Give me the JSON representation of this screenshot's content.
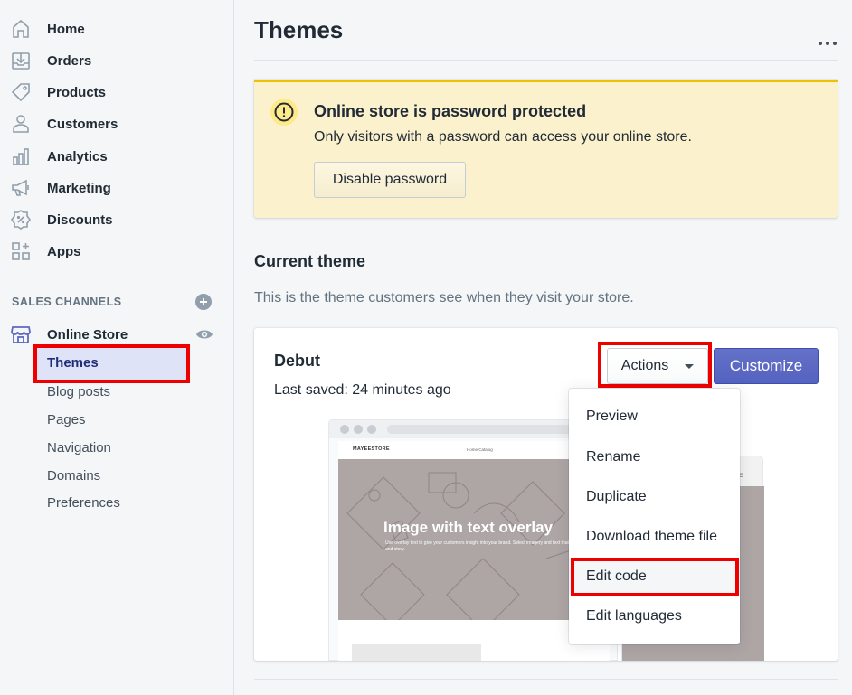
{
  "sidebar": {
    "items": [
      {
        "label": "Home",
        "icon": "home-icon"
      },
      {
        "label": "Orders",
        "icon": "orders-icon"
      },
      {
        "label": "Products",
        "icon": "tag-icon"
      },
      {
        "label": "Customers",
        "icon": "person-icon"
      },
      {
        "label": "Analytics",
        "icon": "bar-chart-icon"
      },
      {
        "label": "Marketing",
        "icon": "megaphone-icon"
      },
      {
        "label": "Discounts",
        "icon": "discount-badge-icon"
      },
      {
        "label": "Apps",
        "icon": "apps-grid-icon"
      }
    ],
    "sales_channels_title": "SALES CHANNELS",
    "online_store": {
      "label": "Online Store",
      "active_sub": "Themes",
      "sub_items": [
        "Blog posts",
        "Pages",
        "Navigation",
        "Domains",
        "Preferences"
      ]
    }
  },
  "main": {
    "title": "Themes",
    "banner": {
      "title": "Online store is password protected",
      "text": "Only visitors with a password can access your online store.",
      "button": "Disable password",
      "accent": "#eec200",
      "background": "#fcf1cd"
    },
    "current_theme": {
      "heading": "Current theme",
      "description": "This is the theme customers see when they visit your store.",
      "name": "Debut",
      "saved": "Last saved: 24 minutes ago",
      "actions_label": "Actions",
      "customize_label": "Customize",
      "preview": {
        "logo": "MAYEESTORE",
        "nav": "Home    Catalog",
        "hero_title": "Image with text overlay",
        "hero_sub": "Use overlay text to give your customers insight into your brand. Select imagery and text that relates to your style and story."
      }
    },
    "actions_menu": [
      "Preview",
      "Rename",
      "Duplicate",
      "Download theme file",
      "Edit code",
      "Edit languages"
    ]
  },
  "colors": {
    "primary": "#5c6ac4",
    "highlight": "#ee0000",
    "active_nav": "#202e78"
  }
}
